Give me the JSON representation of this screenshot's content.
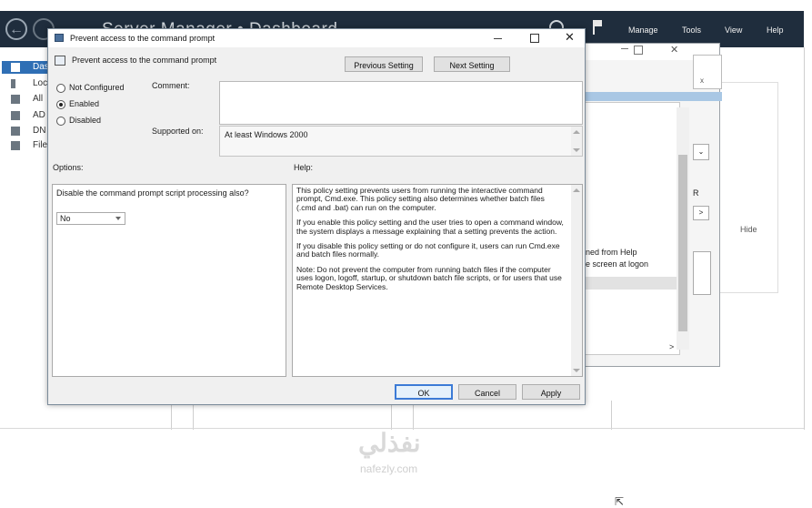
{
  "server_manager": {
    "title": "Server Manager • Dashboard",
    "menu": [
      "Manage",
      "Tools",
      "View",
      "Help"
    ],
    "sidebar": [
      {
        "label": "Das",
        "icon": "dashboard-icon",
        "active": true
      },
      {
        "label": "Loc",
        "icon": "local-server-icon",
        "active": false
      },
      {
        "label": "All",
        "icon": "all-servers-icon",
        "active": false
      },
      {
        "label": "AD",
        "icon": "ad-icon",
        "active": false
      },
      {
        "label": "DN",
        "icon": "dns-icon",
        "active": false
      },
      {
        "label": "File",
        "icon": "file-services-icon",
        "active": false
      }
    ],
    "hide_label": "Hide"
  },
  "back_window": {
    "help_text_1": "ned from Help",
    "help_text_2": "e screen at logon",
    "r_label": "R",
    "arrow": ">",
    "corner_x": "x"
  },
  "dialog": {
    "title": "Prevent access to the command prompt",
    "policy_name": "Prevent access to the command prompt",
    "prev_button": "Previous Setting",
    "next_button": "Next Setting",
    "radios": [
      {
        "label": "Not Configured",
        "checked": false
      },
      {
        "label": "Enabled",
        "checked": true
      },
      {
        "label": "Disabled",
        "checked": false
      }
    ],
    "comment_label": "Comment:",
    "comment_value": "",
    "supported_label": "Supported on:",
    "supported_value": "At least Windows 2000",
    "options_label": "Options:",
    "help_label": "Help:",
    "option_text": "Disable the command prompt script processing also?",
    "option_select_value": "No",
    "help_paragraphs": [
      "This policy setting prevents users from running the interactive command prompt, Cmd.exe.  This policy setting also determines whether batch files (.cmd and .bat) can run on the computer.",
      "If you enable this policy setting and the user tries to open a command window, the system displays a message explaining that a setting prevents the action.",
      "If you disable this policy setting or do not configure it, users can run Cmd.exe and batch files normally.",
      "Note: Do not prevent the computer from running batch files if the computer uses logon, logoff, startup, or shutdown batch file scripts, or for users that use Remote Desktop Services."
    ],
    "ok_button": "OK",
    "cancel_button": "Cancel",
    "apply_button": "Apply"
  },
  "watermark": {
    "arabic": "نفذلي",
    "latin": "nafezly.com"
  },
  "colors": {
    "topbar": "#1f2d3d",
    "accent": "#3c7bd6",
    "dialog_bg": "#f0f0f0"
  }
}
